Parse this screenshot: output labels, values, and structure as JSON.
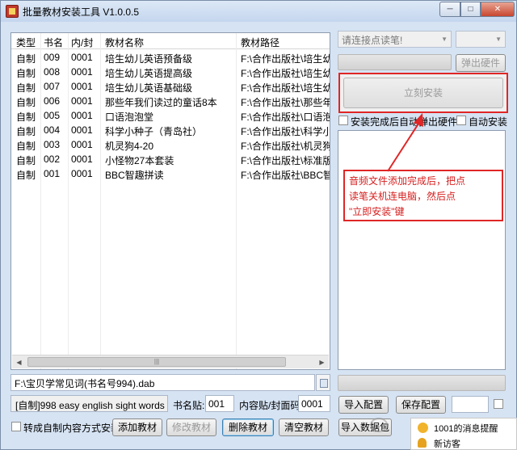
{
  "window": {
    "title": "批量教材安装工具 V1.0.0.5",
    "controls": {
      "minimize": "─",
      "maximize": "□",
      "close": "✕"
    }
  },
  "table": {
    "columns": [
      "类型",
      "书名",
      "内/封",
      "教材名称",
      "教材路径"
    ],
    "rows": [
      [
        "自制",
        "009",
        "0001",
        "培生幼儿英语预备级",
        "F:\\合作出版社\\培生幼儿"
      ],
      [
        "自制",
        "008",
        "0001",
        "培生幼儿英语提高级",
        "F:\\合作出版社\\培生幼儿"
      ],
      [
        "自制",
        "007",
        "0001",
        "培生幼儿英语基础级",
        "F:\\合作出版社\\培生幼儿"
      ],
      [
        "自制",
        "006",
        "0001",
        "那些年我们读过的童话8本",
        "F:\\合作出版社\\那些年我"
      ],
      [
        "自制",
        "005",
        "0001",
        "口语泡泡堂",
        "F:\\合作出版社\\口语泡泡"
      ],
      [
        "自制",
        "004",
        "0001",
        "科学小种子（青岛社）",
        "F:\\合作出版社\\科学小种"
      ],
      [
        "自制",
        "003",
        "0001",
        "机灵狗4-20",
        "F:\\合作出版社\\机灵狗标"
      ],
      [
        "自制",
        "002",
        "0001",
        "小怪物27本套装",
        "F:\\合作出版社\\标准版小"
      ],
      [
        "自制",
        "001",
        "0001",
        "BBC智趣拼读",
        "F:\\合作出版社\\BBC智趣拼"
      ]
    ],
    "scroll_thumb": "|||"
  },
  "path_field": {
    "value": "F:\\宝贝学常见词(书名号994).dab"
  },
  "info": {
    "book_desc": "[自制]998 easy english sight words",
    "book_sticker_label": "书名贴:",
    "book_sticker_value": "001",
    "content_cover_label": "内容贴/封面码:",
    "content_cover_value": "0001"
  },
  "bottom": {
    "convert_checkbox_label": "转成自制内容方式安装",
    "add_btn": "添加教材",
    "modify_btn": "修改教材",
    "delete_btn": "删除教材",
    "clear_btn": "清空教材",
    "import_data_btn": "导入数据包"
  },
  "right": {
    "pen_select_placeholder": "请连接点读笔!",
    "eject_btn": "弹出硬件",
    "install_btn": "立刻安装",
    "auto_eject_label": "安装完成后自动弹出硬件",
    "auto_install_label": "自动安装",
    "import_config_btn": "导入配置",
    "save_config_btn": "保存配置"
  },
  "annotation": {
    "line1": "音频文件添加完成后，把点",
    "line2": "读笔关机连电脑，然后点",
    "line3": "\"立即安装\"键"
  },
  "notification": {
    "message": "1001的消息提醒",
    "visitor": "新访客"
  },
  "colors": {
    "annotation_red": "#e02626",
    "title_bg": "#c4d6ee"
  }
}
